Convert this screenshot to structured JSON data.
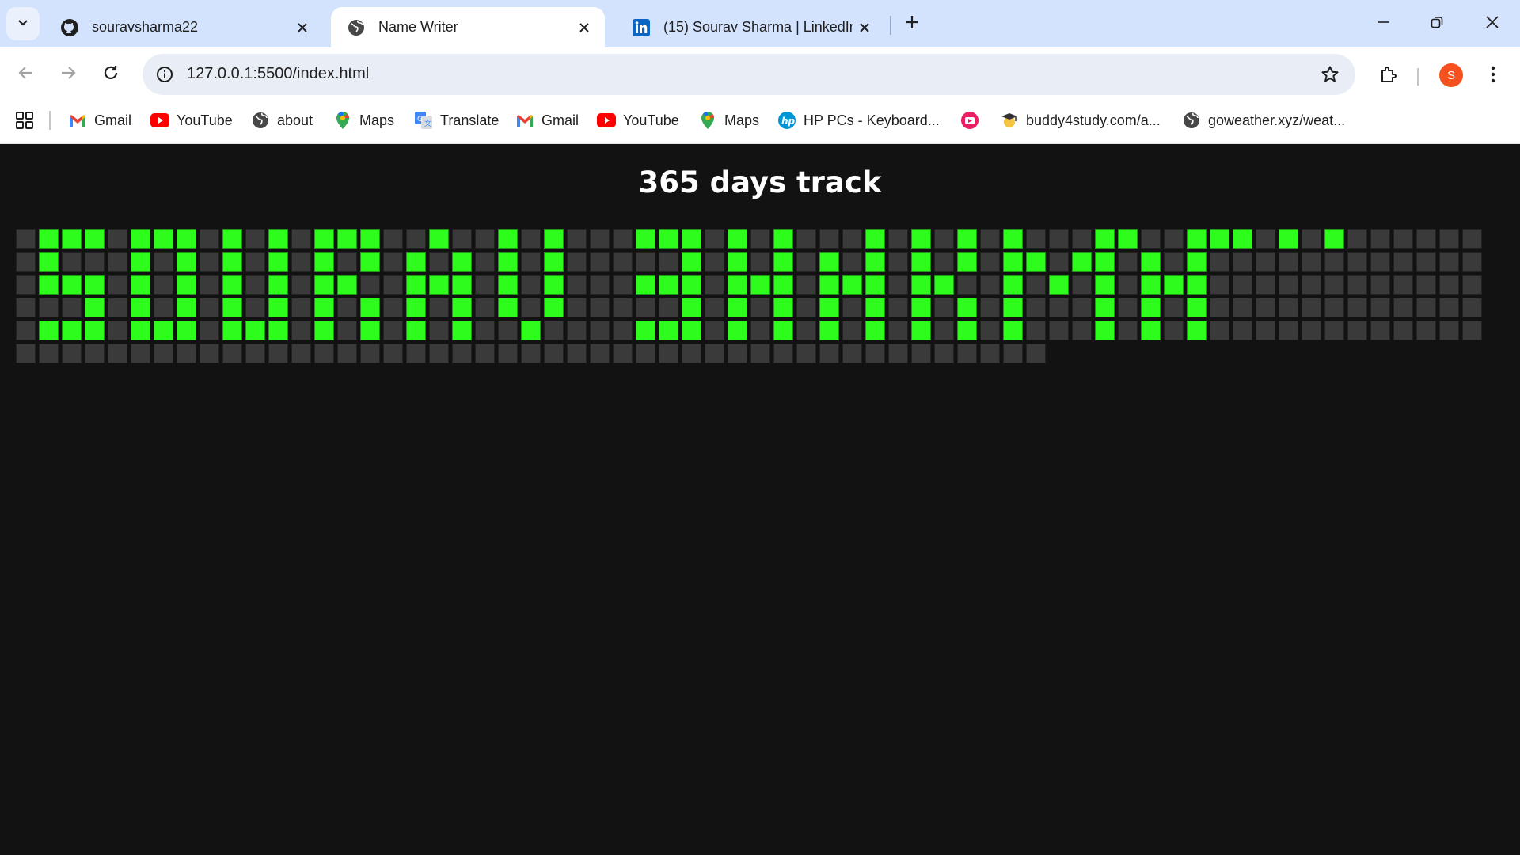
{
  "browser": {
    "tabs": [
      {
        "title": "souravsharma22",
        "icon": "github-icon",
        "active": false
      },
      {
        "title": "Name Writer",
        "icon": "globe-icon",
        "active": true
      },
      {
        "title": "(15) Sourav Sharma | LinkedIn",
        "icon": "linkedin-icon",
        "active": false
      }
    ],
    "url": "127.0.0.1:5500/index.html",
    "profile_initial": "S",
    "profile_color": "#f4511e",
    "tabstrip_color": "#d3e3fd"
  },
  "bookmarks": [
    {
      "label": "Gmail",
      "icon": "gmail-icon"
    },
    {
      "label": "YouTube",
      "icon": "youtube-icon"
    },
    {
      "label": "about",
      "icon": "globe-icon"
    },
    {
      "label": "Maps",
      "icon": "maps-icon"
    },
    {
      "label": "Translate",
      "icon": "translate-icon"
    },
    {
      "label": "Gmail",
      "icon": "gmail-icon"
    },
    {
      "label": "YouTube",
      "icon": "youtube-icon"
    },
    {
      "label": "Maps",
      "icon": "maps-icon"
    },
    {
      "label": "HP PCs - Keyboard...",
      "icon": "hp-icon"
    },
    {
      "label": "",
      "icon": "media-icon"
    },
    {
      "label": "buddy4study.com/a...",
      "icon": "graduate-icon"
    },
    {
      "label": "goweather.xyz/weat...",
      "icon": "globe-icon"
    }
  ],
  "page": {
    "title": "365 days track",
    "background": "#121212",
    "tracker": {
      "total_days": 365,
      "rows": 7,
      "active_color": "#2dfc1d",
      "inactive_color": "#3a3a3a",
      "active_days": [
        1,
        2,
        3,
        5,
        6,
        7,
        9,
        11,
        13,
        14,
        15,
        18,
        21,
        23,
        27,
        28,
        29,
        31,
        33,
        37,
        39,
        41,
        43,
        47,
        48,
        51,
        52,
        53,
        55,
        57,
        1,
        5,
        7,
        9,
        11,
        13,
        15,
        17,
        19,
        21,
        23,
        29,
        31,
        33,
        35,
        37,
        39,
        41,
        43,
        44,
        46,
        47,
        49,
        51,
        1,
        2,
        3,
        5,
        7,
        9,
        11,
        13,
        14,
        17,
        18,
        19,
        21,
        23,
        27,
        28,
        29,
        31,
        32,
        33,
        35,
        36,
        37,
        39,
        40,
        43,
        45,
        47,
        49,
        50,
        51,
        3,
        5,
        7,
        9,
        11,
        13,
        15,
        17,
        19,
        21,
        23,
        29,
        31,
        33,
        35,
        37,
        39,
        41,
        43,
        47,
        49,
        51,
        1,
        2,
        3,
        5,
        6,
        7,
        9,
        10,
        11,
        13,
        15,
        17,
        19,
        22,
        27,
        28,
        29,
        31,
        33,
        35,
        37,
        39,
        41,
        43,
        47,
        49,
        51
      ]
    }
  }
}
